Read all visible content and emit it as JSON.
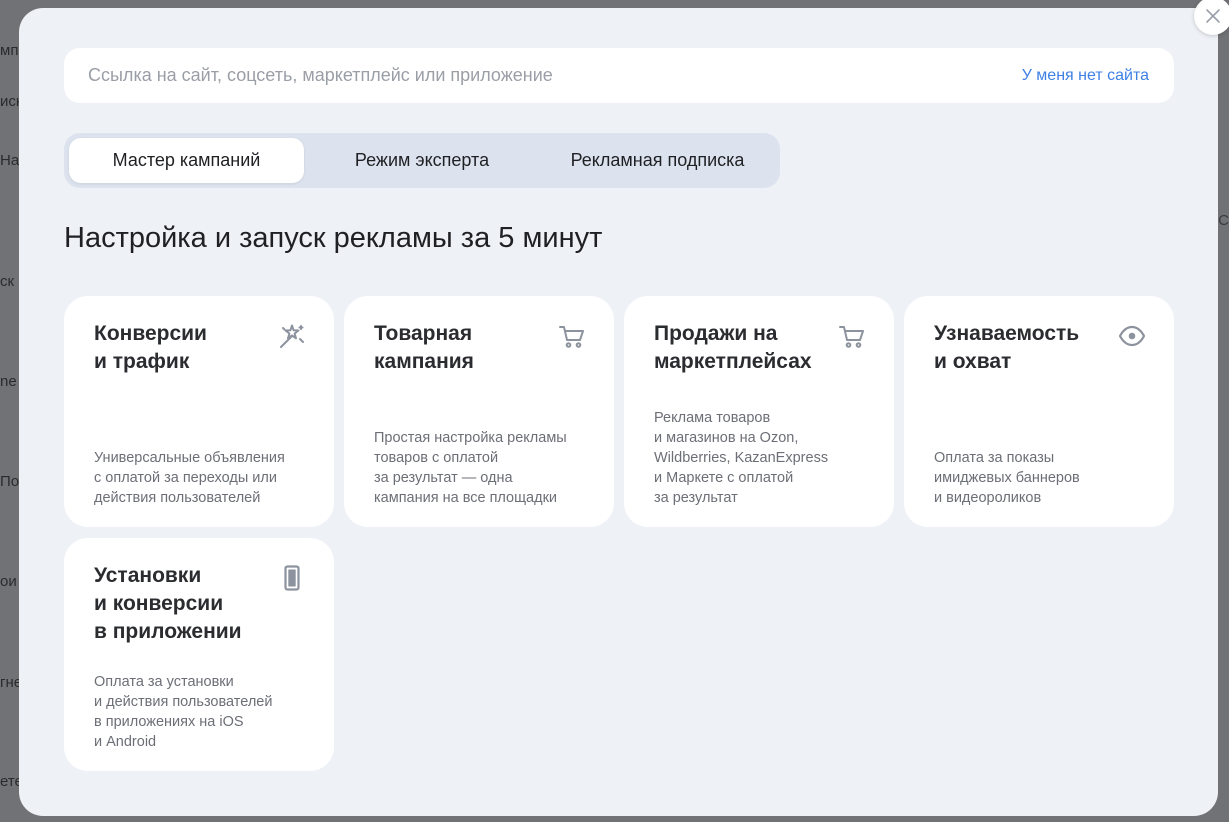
{
  "background_page": {
    "fragments": [
      "мп",
      "иск",
      "На",
      "ск",
      "ne",
      "По",
      "ои",
      "гне",
      "ете",
      "С"
    ]
  },
  "modal": {
    "close_icon": "close-icon",
    "url_bar": {
      "placeholder": "Ссылка на сайт, соцсеть, маркетплейс или приложение",
      "value": "",
      "no_site_link": "У меня нет сайта"
    },
    "tabs": [
      {
        "label": "Мастер кампаний",
        "active": true
      },
      {
        "label": "Режим эксперта",
        "active": false
      },
      {
        "label": "Рекламная подписка",
        "active": false
      }
    ],
    "heading": "Настройка и запуск рекламы за 5 минут",
    "cards": [
      {
        "title": "Конверсии\nи трафик",
        "description": "Универсальные объявления\nс оплатой за переходы или\nдействия пользователей",
        "icon": "magic-wand-icon"
      },
      {
        "title": "Товарная\nкампания",
        "description": "Простая настройка рекламы\nтоваров с оплатой\nза результат — одна\nкампания на все площадки",
        "icon": "cart-icon"
      },
      {
        "title": "Продажи на\nмаркетплейсах",
        "description": "Реклама товаров\nи магазинов на Ozon,\nWildberries, KazanExpress\nи Маркете с оплатой\nза результат",
        "icon": "cart-icon"
      },
      {
        "title": "Узнаваемость\nи охват",
        "description": "Оплата за показы\nимиджевых баннеров\nи видеороликов",
        "icon": "eye-icon"
      },
      {
        "title": "Установки\nи конверсии\nв приложении",
        "description": "Оплата за установки\nи действия пользователей\nв приложениях на iOS\nи Android",
        "icon": "smartphone-icon"
      }
    ]
  },
  "colors": {
    "modal_background": "#eef1f6",
    "card_background": "#ffffff",
    "link": "#3f80e5",
    "tabs_background": "#dde3ee",
    "icon": "#8d939e"
  }
}
